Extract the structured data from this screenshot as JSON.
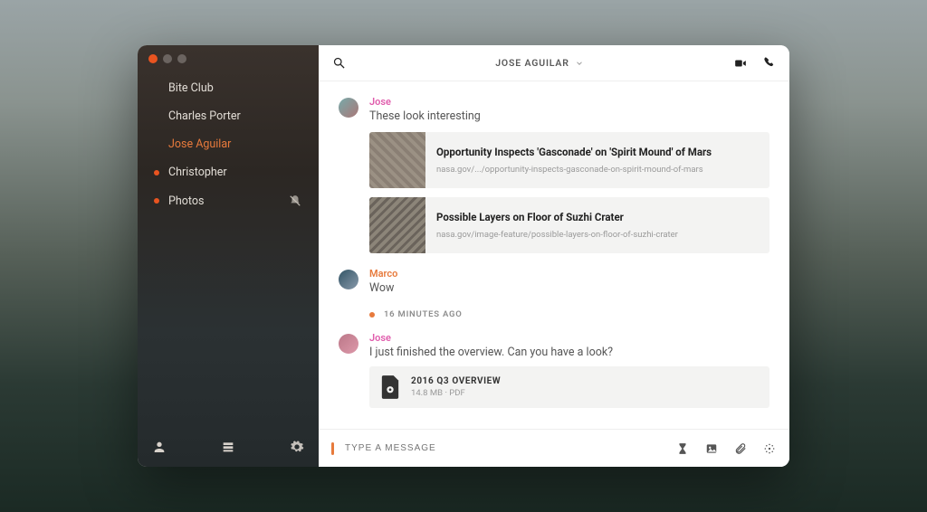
{
  "header": {
    "title": "JOSE AGUILAR"
  },
  "sidebar": {
    "items": [
      {
        "label": "Bite Club",
        "unread": false,
        "active": false,
        "muted": false
      },
      {
        "label": "Charles Porter",
        "unread": false,
        "active": false,
        "muted": false
      },
      {
        "label": "Jose Aguilar",
        "unread": false,
        "active": true,
        "muted": false
      },
      {
        "label": "Christopher",
        "unread": true,
        "active": false,
        "muted": false
      },
      {
        "label": "Photos",
        "unread": true,
        "active": false,
        "muted": true
      }
    ]
  },
  "messages": {
    "jose1": {
      "sender": "Jose",
      "text": "These look interesting",
      "links": [
        {
          "title": "Opportunity Inspects 'Gasconade' on 'Spirit Mound' of Mars",
          "url": "nasa.gov/.../opportunity-inspects-gasconade-on-spirit-mound-of-mars"
        },
        {
          "title": "Possible Layers on Floor of Suzhi Crater",
          "url": "nasa.gov/image-feature/possible-layers-on-floor-of-suzhi-crater"
        }
      ]
    },
    "marco": {
      "sender": "Marco",
      "text": "Wow"
    },
    "time_separator": "16 MINUTES AGO",
    "jose2": {
      "sender": "Jose",
      "text": "I just finished the overview. Can you have a look?",
      "file": {
        "name": "2016 Q3 OVERVIEW",
        "meta": "14.8 MB · PDF"
      }
    }
  },
  "composer": {
    "placeholder": "TYPE A MESSAGE"
  }
}
